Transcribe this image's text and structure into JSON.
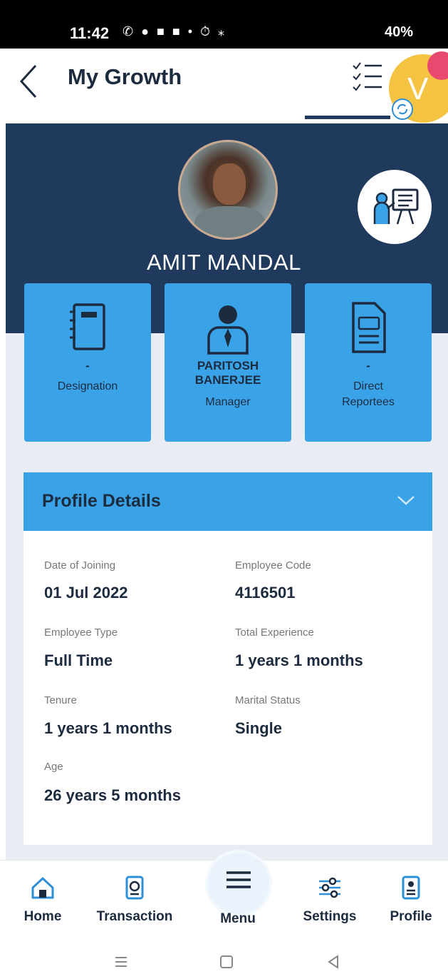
{
  "status_bar": {
    "time": "11:42",
    "battery": "40%"
  },
  "header": {
    "title": "My Growth",
    "avatar_initial": "V"
  },
  "profile": {
    "name": "AMIT MANDAL"
  },
  "cards": [
    {
      "value": "-",
      "label": "Designation"
    },
    {
      "value": "PARITOSH BANERJEE",
      "label": "Manager"
    },
    {
      "value": "-",
      "label": "Direct Reportees"
    }
  ],
  "details": {
    "title": "Profile Details",
    "fields": [
      {
        "label": "Date of Joining",
        "value": "01 Jul 2022"
      },
      {
        "label": "Employee Code",
        "value": "4116501"
      },
      {
        "label": "Employee Type",
        "value": "Full Time"
      },
      {
        "label": "Total Experience",
        "value": "1 years 1 months"
      },
      {
        "label": "Tenure",
        "value": "1 years 1 months"
      },
      {
        "label": "Marital Status",
        "value": "Single"
      },
      {
        "label": "Age",
        "value": "26 years 5 months"
      }
    ]
  },
  "bottom_nav": [
    {
      "label": "Home",
      "icon": "home-icon"
    },
    {
      "label": "Transaction",
      "icon": "transaction-icon"
    },
    {
      "label": "Menu",
      "icon": "menu-icon"
    },
    {
      "label": "Settings",
      "icon": "settings-icon"
    },
    {
      "label": "Profile",
      "icon": "profile-icon"
    }
  ],
  "colors": {
    "navy": "#1f3a5c",
    "accent_blue": "#3aa3e8",
    "text_dark": "#1d2b3f"
  }
}
